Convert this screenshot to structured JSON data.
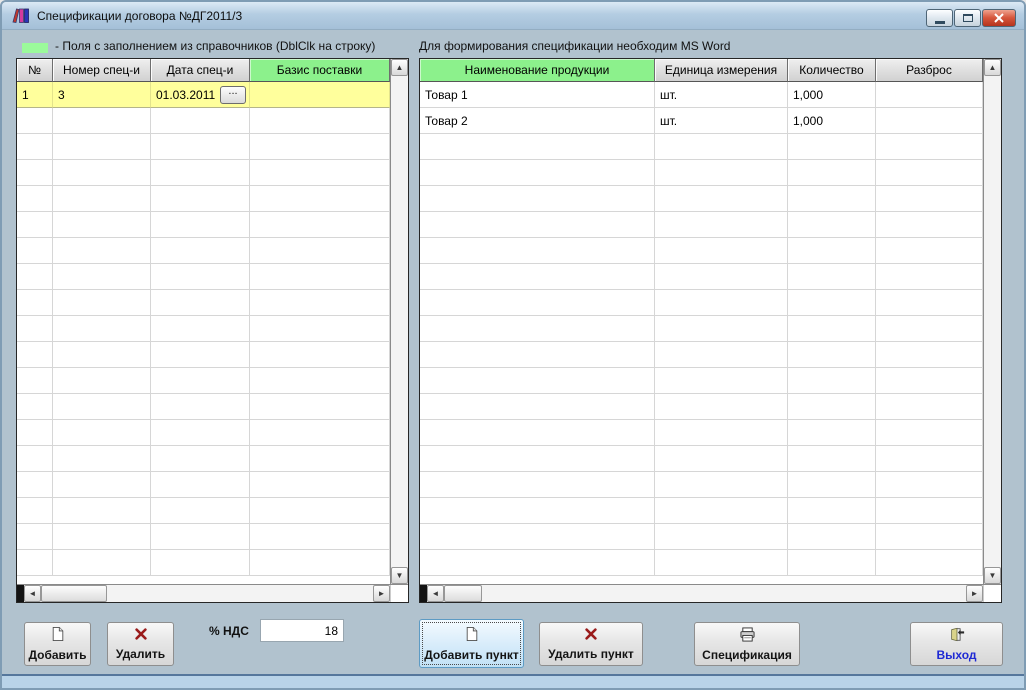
{
  "window": {
    "title": "Спецификации договора №ДГ2011/3"
  },
  "left_panel": {
    "legend_text": "- Поля с заполнением из справочников (DblClk на строку)",
    "table": {
      "columns": [
        "№",
        "Номер спец-и",
        "Дата спец-и",
        "Базис поставки"
      ],
      "date_button_label": "...",
      "rows": [
        {
          "num": "1",
          "spec_number": "3",
          "spec_date": "01.03.2011",
          "delivery_basis": "",
          "selected": true,
          "has_date_button": true
        }
      ],
      "empty_row_count": 18
    },
    "add_button_label": "Добавить",
    "delete_button_label": "Удалить",
    "vat_label": "% НДС",
    "vat_value": "18"
  },
  "right_panel": {
    "hint": "Для формирования спецификации необходим MS Word",
    "table": {
      "columns": [
        "Наименование продукции",
        "Единица измерения",
        "Количество",
        "Разброс"
      ],
      "rows": [
        {
          "name": "Товар 1",
          "unit": "шт.",
          "quantity": "1,000",
          "spread": ""
        },
        {
          "name": "Товар 2",
          "unit": "шт.",
          "quantity": "1,000",
          "spread": ""
        }
      ],
      "empty_row_count": 17
    },
    "add_item_button_label": "Добавить пункт",
    "delete_item_button_label": "Удалить пункт",
    "specification_button_label": "Спецификация",
    "exit_button_label": "Выход"
  },
  "colors": {
    "reference_field_green": "#8cf18c",
    "selected_row_yellow": "#ffff9c",
    "exit_text_blue": "#1f2ad4",
    "delete_x_red": "#9a1b1b"
  }
}
